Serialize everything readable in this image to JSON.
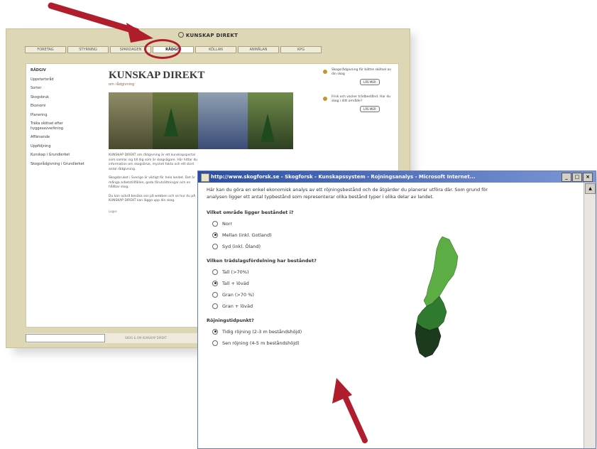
{
  "back_window": {
    "logo": "KUNSKAP DIREKT",
    "nav_tabs": [
      "FORETAG",
      "STYRNING",
      "SPARDAGEN",
      "RÅDGIV",
      "KÖLLAN",
      "ANMÄLAN",
      "KPG"
    ],
    "active_tab_index": 3,
    "sidebar": [
      "RÅDGIV",
      "Uppstartsråd",
      "Sorter",
      "Skogsbruk",
      "Ekonomi",
      "Planering",
      "Träka skötsel efter hyggesavverkning",
      "Affärsande",
      "Uppföljning",
      "Kunskap i Grundlerket",
      "Skogsrådgivning i Grundlerket"
    ],
    "title": "KUNSKAP DIREKT",
    "subtitle": "om rådgivning",
    "paragraphs": [
      "KUNSKAP DIREKT om rådgivning är ett kunskapsportal som samlar sig till dig som är skogsägare. Här hittar du information om skogsbruk, mycket fakta och ett stort antal rådgivning.",
      "Skogsbruket i Sverige är viktigt för hela landet. Det är många arbetstillfällen, goda förutsättningar och en hållbar skog.",
      "Du kan också besöka oss på webben och se hur du på KUNSKAP DIREKT kan lägga upp din skog."
    ],
    "logos_label": "Logos",
    "right_items": [
      {
        "text": "Skogsrådgivning för bättre skötsel av din skog",
        "button": "LÄS MER"
      },
      {
        "text": "Frisk och vacker trädbestånd. Har du skog i ditt område?",
        "button": "LÄS MER"
      }
    ],
    "footer_text": "SKOG & OM KUNSKAP DIREKT"
  },
  "fore_window": {
    "title": "http://www.skogforsk.se - Skogforsk - Kunskapssystem - Rojningsanalys - Microsoft Internet...",
    "intro": "Här kan du göra en enkel ekonomisk analys av ett röjningsbestånd och de åtgärder du planerar utföra där. Som grund för analysen ligger ett antal typbestånd som representerar olika bestånd typer i olika delar av landet.",
    "questions": [
      {
        "label": "Vilket område ligger beståndet i?",
        "options": [
          {
            "label": "Norr",
            "checked": false
          },
          {
            "label": "Mellan (inkl. Gotland)",
            "checked": true
          },
          {
            "label": "Syd (inkl. Öland)",
            "checked": false
          }
        ]
      },
      {
        "label": "Vilken trädslagsfördelning har beståndet?",
        "options": [
          {
            "label": "Tall (>70%)",
            "checked": false
          },
          {
            "label": "Tall + löväd",
            "checked": true
          },
          {
            "label": "Gran (>70 %)",
            "checked": false
          },
          {
            "label": "Gran + löväd",
            "checked": false
          }
        ]
      },
      {
        "label": "Röjningstidpunkt?",
        "options": [
          {
            "label": "Tidig röjning (2-3 m beståndshöjd)",
            "checked": true
          },
          {
            "label": "Sen röjning (4-5 m beståndshöjd)",
            "checked": false
          }
        ]
      }
    ]
  },
  "colors": {
    "frame": "#ddd7b5",
    "title_bar": "#2a4ea6",
    "arrow": "#b01e2d",
    "map_north": "#5cad44",
    "map_middle": "#2f7a2e",
    "map_south": "#1b3a1e"
  }
}
